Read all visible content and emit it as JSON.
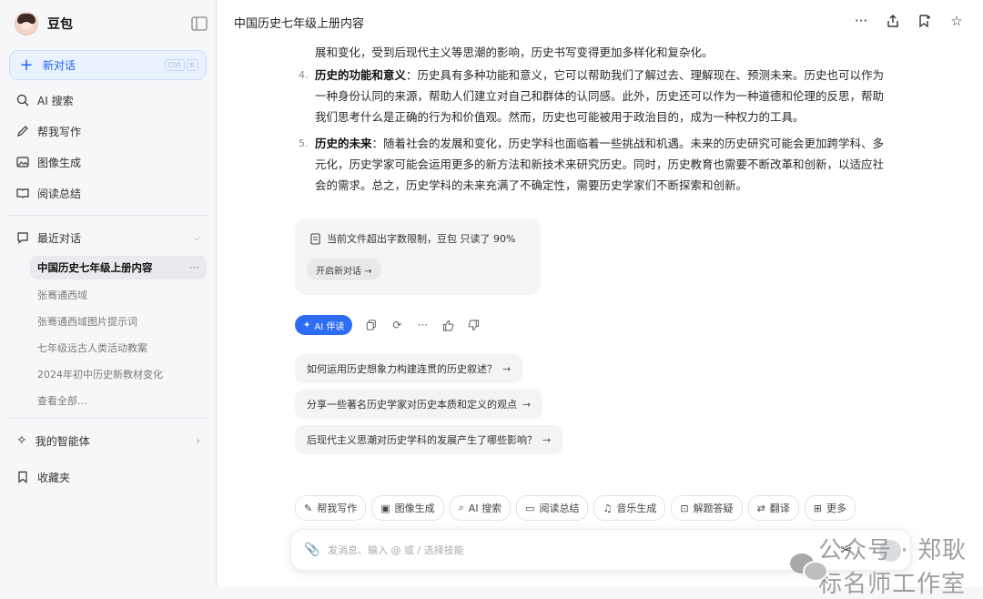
{
  "sidebar": {
    "brand": "豆包",
    "new_chat": "新对话",
    "new_chat_shortcut": [
      "Ctrl",
      "K"
    ],
    "nav": [
      {
        "label": "AI 搜索",
        "icon": "search-spark-icon"
      },
      {
        "label": "帮我写作",
        "icon": "pen-icon"
      },
      {
        "label": "图像生成",
        "icon": "image-icon"
      },
      {
        "label": "阅读总结",
        "icon": "book-icon"
      }
    ],
    "recent_title": "最近对话",
    "recent_active": "中国历史七年级上册内容",
    "recent_items": [
      "张骞通西域",
      "张骞通西域图片提示词",
      "七年级远古人类活动教案",
      "2024年初中历史新教材变化",
      "查看全部..."
    ],
    "agents": "我的智能体",
    "favorites": "收藏夹"
  },
  "header": {
    "title": "中国历史七年级上册内容"
  },
  "content": {
    "prev_tail": "展和变化，受到后现代主义等思潮的影响，历史书写变得更加多样化和复杂化。",
    "items": [
      {
        "num": "4.",
        "title": "历史的功能和意义",
        "body": "：历史具有多种功能和意义，它可以帮助我们了解过去、理解现在、预测未来。历史也可以作为一种身份认同的来源，帮助人们建立对自己和群体的认同感。此外，历史还可以作为一种道德和伦理的反思，帮助我们思考什么是正确的行为和价值观。然而，历史也可能被用于政治目的，成为一种权力的工具。"
      },
      {
        "num": "5.",
        "title": "历史的未来",
        "body": "：随着社会的发展和变化，历史学科也面临着一些挑战和机遇。未来的历史研究可能会更加跨学科、多元化，历史学家可能会运用更多的新方法和新技术来研究历史。同时，历史教育也需要不断改革和创新，以适应社会的需求。总之，历史学科的未来充满了不确定性，需要历史学家们不断探索和创新。"
      }
    ],
    "notice": "当前文件超出字数限制，豆包 只读了 90%",
    "notice_button": "开启新对话 →",
    "ai_read": "AI 伴读",
    "suggestions": [
      "如何运用历史想象力构建连贯的历史叙述？",
      "分享一些著名历史学家对历史本质和定义的观点",
      "后现代主义思潮对历史学科的发展产生了哪些影响？"
    ]
  },
  "tools": [
    {
      "label": "帮我写作",
      "icon": "pen-icon"
    },
    {
      "label": "图像生成",
      "icon": "image-icon"
    },
    {
      "label": "AI 搜索",
      "icon": "search-spark-icon"
    },
    {
      "label": "阅读总结",
      "icon": "book-icon"
    },
    {
      "label": "音乐生成",
      "icon": "music-icon"
    },
    {
      "label": "解题答疑",
      "icon": "question-icon"
    },
    {
      "label": "翻译",
      "icon": "translate-icon"
    },
    {
      "label": "更多",
      "icon": "grid-icon"
    }
  ],
  "input": {
    "placeholder": "发消息、输入 @ 或 / 选择技能"
  },
  "watermark": "公众号 · 郑耿标名师工作室",
  "colors": {
    "accent": "#2f6cf6",
    "new_chat_bg": "#eaf1ff"
  }
}
